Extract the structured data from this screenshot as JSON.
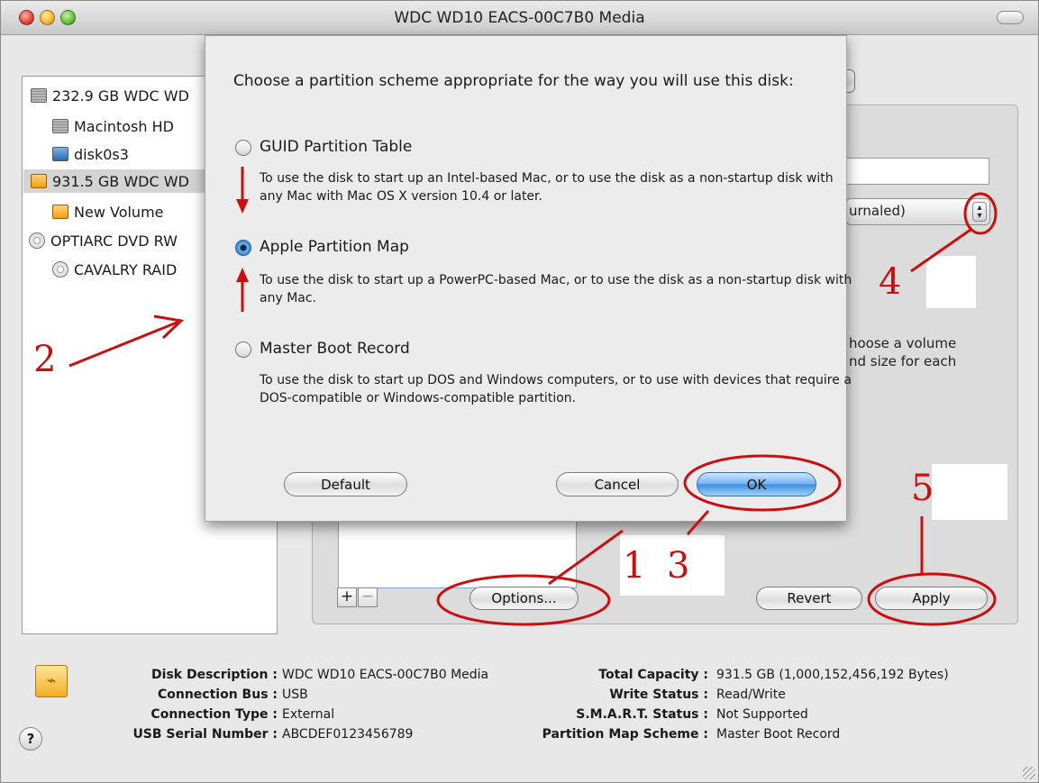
{
  "window": {
    "title": "WDC WD10 EACS-00C7B0 Media"
  },
  "sidebar": {
    "items": [
      {
        "label": "232.9 GB WDC WD",
        "icon": "internal-disk-icon"
      },
      {
        "label": "Macintosh HD",
        "icon": "volume-icon"
      },
      {
        "label": "disk0s3",
        "icon": "volume-icon"
      },
      {
        "label": "931.5 GB WDC WD",
        "icon": "external-disk-icon",
        "selected": true
      },
      {
        "label": "New Volume",
        "icon": "external-volume-icon"
      },
      {
        "label": "OPTIARC DVD RW",
        "icon": "optical-drive-icon"
      },
      {
        "label": "CAVALRY RAID",
        "icon": "optical-disc-icon"
      }
    ]
  },
  "partition_panel": {
    "format_popup_partial": "urnaled)",
    "info_text": [
      "hoose a volume",
      "nd size for each"
    ],
    "add_label": "+",
    "remove_label": "−",
    "options_label": "Options...",
    "revert_label": "Revert",
    "apply_label": "Apply"
  },
  "sheet": {
    "prompt": "Choose a partition scheme appropriate for the way you will use this disk:",
    "options": [
      {
        "label": "GUID Partition Table",
        "selected": false,
        "description": "To use the disk to start up an Intel-based Mac, or to use the disk as a non-startup disk with any Mac with Mac OS X version 10.4 or later."
      },
      {
        "label": "Apple Partition Map",
        "selected": true,
        "description": "To use the disk to start up a PowerPC-based Mac, or to use the disk as a non-startup disk with any Mac."
      },
      {
        "label": "Master Boot Record",
        "selected": false,
        "description": "To use the disk to start up DOS and Windows computers, or to use with devices that require a DOS-compatible or Windows-compatible partition."
      }
    ],
    "default_label": "Default",
    "cancel_label": "Cancel",
    "ok_label": "OK"
  },
  "disk_info": {
    "left": [
      {
        "label": "Disk Description :",
        "value": "WDC WD10 EACS-00C7B0 Media"
      },
      {
        "label": "Connection Bus :",
        "value": "USB"
      },
      {
        "label": "Connection Type :",
        "value": "External"
      },
      {
        "label": "USB Serial Number :",
        "value": "ABCDEF0123456789"
      }
    ],
    "right": [
      {
        "label": "Total Capacity :",
        "value": "931.5 GB (1,000,152,456,192 Bytes)"
      },
      {
        "label": "Write Status :",
        "value": "Read/Write"
      },
      {
        "label": "S.M.A.R.T. Status :",
        "value": "Not Supported"
      },
      {
        "label": "Partition Map Scheme :",
        "value": "Master Boot Record"
      }
    ]
  },
  "help_label": "?",
  "annotations": {
    "step1": "1",
    "step2": "2",
    "step3": "3",
    "step4": "4",
    "step5": "5",
    "color": "#c81010"
  }
}
